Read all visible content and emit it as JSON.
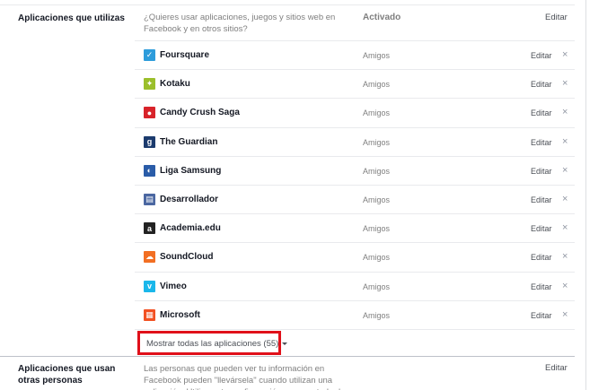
{
  "section1": {
    "label": "Aplicaciones que utilizas",
    "description": "¿Quieres usar aplicaciones, juegos y sitios web en Facebook y en otros sitios?",
    "status": "Activado",
    "edit_label": "Editar"
  },
  "apps": [
    {
      "name": "Foursquare",
      "audience": "Amigos",
      "edit": "Editar",
      "remove": "×",
      "icon": "foursquare-icon",
      "color": "#2d9cdb"
    },
    {
      "name": "Kotaku",
      "audience": "Amigos",
      "edit": "Editar",
      "remove": "×",
      "icon": "kotaku-icon",
      "color": "#9bbf2b"
    },
    {
      "name": "Candy Crush Saga",
      "audience": "Amigos",
      "edit": "Editar",
      "remove": "×",
      "icon": "candy-crush-icon",
      "color": "#d8232a"
    },
    {
      "name": "The Guardian",
      "audience": "Amigos",
      "edit": "Editar",
      "remove": "×",
      "icon": "guardian-icon",
      "color": "#1c3b6e"
    },
    {
      "name": "Liga Samsung",
      "audience": "Amigos",
      "edit": "Editar",
      "remove": "×",
      "icon": "liga-samsung-icon",
      "color": "#2a5ca8"
    },
    {
      "name": "Desarrollador",
      "audience": "Amigos",
      "edit": "Editar",
      "remove": "×",
      "icon": "developer-icon",
      "color": "#4b67a1"
    },
    {
      "name": "Academia.edu",
      "audience": "Amigos",
      "edit": "Editar",
      "remove": "×",
      "icon": "academia-icon",
      "color": "#222222"
    },
    {
      "name": "SoundCloud",
      "audience": "Amigos",
      "edit": "Editar",
      "remove": "×",
      "icon": "soundcloud-icon",
      "color": "#f26f23"
    },
    {
      "name": "Vimeo",
      "audience": "Amigos",
      "edit": "Editar",
      "remove": "×",
      "icon": "vimeo-icon",
      "color": "#1ab7ea"
    },
    {
      "name": "Microsoft",
      "audience": "Amigos",
      "edit": "Editar",
      "remove": "×",
      "icon": "microsoft-icon",
      "color": "#f25022"
    }
  ],
  "show_all": {
    "label": "Mostrar todas las aplicaciones (55)"
  },
  "section2": {
    "label": "Aplicaciones que usan otras personas",
    "description": "Las personas que pueden ver tu información en Facebook pueden \"llevársela\" cuando utilizan una aplicación. Utiliza esta configuración para controlar las",
    "edit_label": "Editar"
  }
}
